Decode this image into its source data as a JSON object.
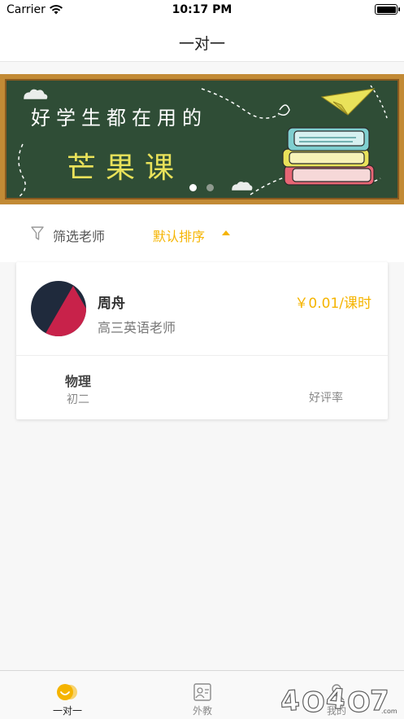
{
  "status_bar": {
    "carrier": "Carrier",
    "time": "10:17 PM",
    "icons": [
      "wifi-icon",
      "battery-icon"
    ]
  },
  "nav": {
    "title": "一对一"
  },
  "banner": {
    "line1": "好学生都在用的",
    "line2": "芒果课",
    "page_count": 2,
    "active_page": 1
  },
  "filter": {
    "filter_label": "筛选老师",
    "sort_label": "默认排序",
    "filter_icon": "funnel-icon",
    "sort_icon": "caret-up-icon"
  },
  "teacher_card": {
    "name": "周舟",
    "title": "高三英语老师",
    "price": "￥0.01/课时",
    "course": {
      "subject": "物理",
      "grade": "初二",
      "rating_label": "好评率"
    }
  },
  "tab_bar": {
    "tabs": [
      {
        "label": "一对一",
        "icon": "smiley-icon",
        "active": true
      },
      {
        "label": "外教",
        "icon": "id-card-icon",
        "active": false
      },
      {
        "label": "我的",
        "icon": "person-icon",
        "active": false
      }
    ]
  },
  "colors": {
    "accent": "#f5b400",
    "board": "#2f4d36",
    "frame": "#c28a35",
    "banner_highlight": "#e9e25a"
  }
}
